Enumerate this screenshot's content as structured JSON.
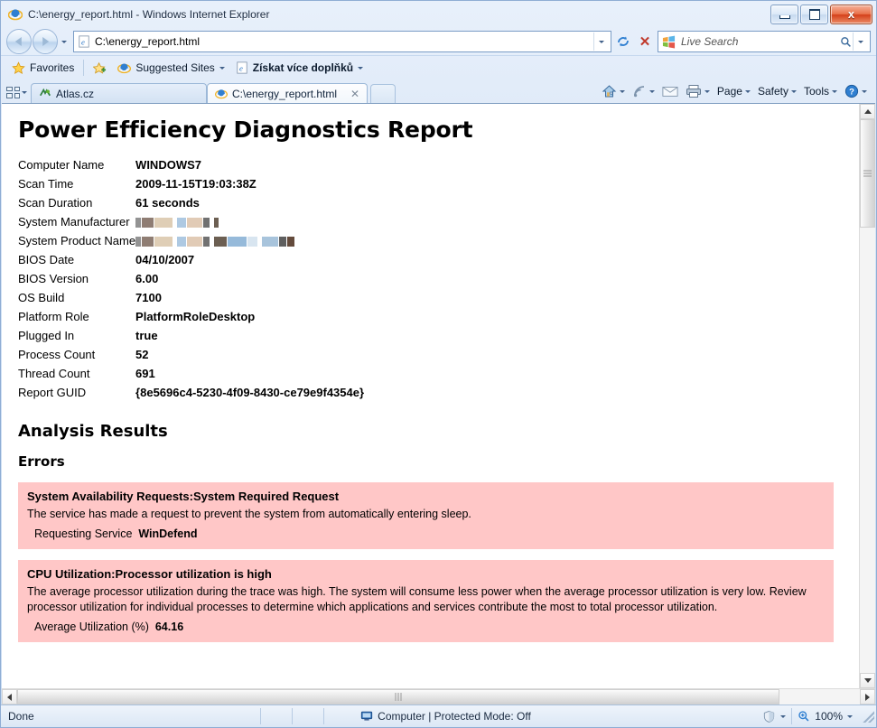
{
  "window": {
    "title": "C:\\energy_report.html - Windows Internet Explorer",
    "minimize_label": "Minimize",
    "maximize_label": "Maximize",
    "close_label": "x"
  },
  "address_bar": {
    "url": "C:\\energy_report.html",
    "back_label": "Back",
    "forward_label": "Forward",
    "recent_pages_label": "Recent Pages",
    "refresh_label": "Refresh",
    "stop_label": "✕",
    "dropdown_label": "Previous Pages"
  },
  "search": {
    "placeholder": "Live Search",
    "go_label": "Search",
    "provider_dropdown_label": "Search Options"
  },
  "favorites_bar": {
    "favorites_label": "Favorites",
    "suggested_sites_label": "Suggested Sites",
    "get_addons_label": "Získat více doplňků"
  },
  "tabs": {
    "quick_tabs_label": "Quick Tabs",
    "tab_list_label": "Tab List",
    "items": [
      {
        "label": "Atlas.cz",
        "active": false,
        "icon": "atlas-icon"
      },
      {
        "label": "C:\\energy_report.html",
        "active": true,
        "icon": "ie-icon",
        "close_label": "✕"
      }
    ],
    "new_tab_label": "New Tab"
  },
  "command_bar": {
    "home_label": "Home",
    "feeds_label": "Feeds",
    "mail_label": "Read Mail",
    "print_label": "Print",
    "page_label": "Page",
    "safety_label": "Safety",
    "tools_label": "Tools",
    "help_label": "Help"
  },
  "report": {
    "title": "Power Efficiency Diagnostics Report",
    "system_info": [
      {
        "key": "Computer Name",
        "value": "WINDOWS7",
        "redacted": false
      },
      {
        "key": "Scan Time",
        "value": "2009-11-15T19:03:38Z",
        "redacted": false
      },
      {
        "key": "Scan Duration",
        "value": "61 seconds",
        "redacted": false
      },
      {
        "key": "System Manufacturer",
        "value": "",
        "redacted": true,
        "redacted_width": 92
      },
      {
        "key": "System Product Name",
        "value": "",
        "redacted": true,
        "redacted_width": 176
      },
      {
        "key": "BIOS Date",
        "value": "04/10/2007",
        "redacted": false
      },
      {
        "key": "BIOS Version",
        "value": "6.00",
        "redacted": false
      },
      {
        "key": "OS Build",
        "value": "7100",
        "redacted": false
      },
      {
        "key": "Platform Role",
        "value": "PlatformRoleDesktop",
        "redacted": false
      },
      {
        "key": "Plugged In",
        "value": "true",
        "redacted": false
      },
      {
        "key": "Process Count",
        "value": "52",
        "redacted": false
      },
      {
        "key": "Thread Count",
        "value": "691",
        "redacted": false
      },
      {
        "key": "Report GUID",
        "value": "{8e5696c4-5230-4f09-8430-ce79e9f4354e}",
        "redacted": false
      }
    ],
    "analysis_heading": "Analysis Results",
    "errors_heading": "Errors",
    "errors": [
      {
        "title": "System Availability Requests:System Required Request",
        "description": "The service has made a request to prevent the system from automatically entering sleep.",
        "detail_key": "Requesting Service",
        "detail_value": "WinDefend"
      },
      {
        "title": "CPU Utilization:Processor utilization is high",
        "description": "The average processor utilization during the trace was high. The system will consume less power when the average processor utilization is very low. Review processor utilization for individual processes to determine which applications and services contribute the most to total processor utilization.",
        "detail_key": "Average Utilization (%)",
        "detail_value": "64.16"
      }
    ],
    "error_box_color": "#ffc7c7"
  },
  "status_bar": {
    "status_text": "Done",
    "zone_text": "Computer | Protected Mode: Off",
    "zoom_text": "100%",
    "zone_dropdown_label": "Change Zone",
    "zoom_dropdown_label": "Change Zoom Level"
  }
}
